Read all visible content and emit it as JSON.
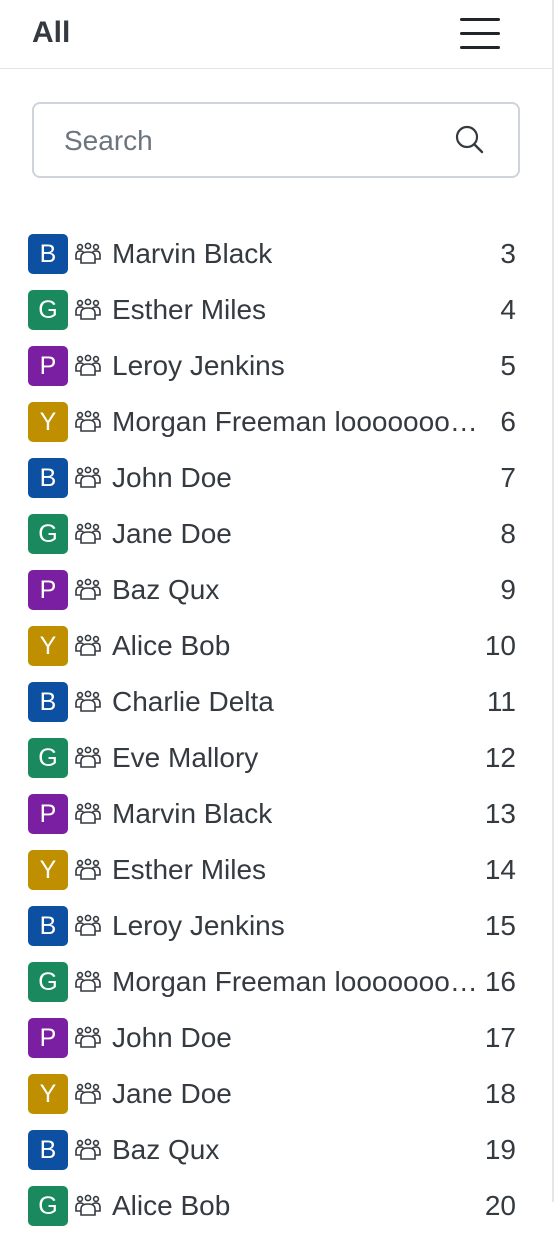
{
  "header": {
    "title": "All"
  },
  "search": {
    "placeholder": "Search",
    "value": ""
  },
  "colors": {
    "B": "#0d4fa0",
    "G": "#1a8a5e",
    "P": "#7b1fa2",
    "Y": "#bf8f00"
  },
  "items": [
    {
      "letter": "B",
      "color": "#0d4fa0",
      "name": "Marvin Black",
      "count": "3"
    },
    {
      "letter": "G",
      "color": "#1a8a5e",
      "name": "Esther Miles",
      "count": "4"
    },
    {
      "letter": "P",
      "color": "#7b1fa2",
      "name": "Leroy Jenkins",
      "count": "5"
    },
    {
      "letter": "Y",
      "color": "#bf8f00",
      "name": "Morgan Freeman looooooooooooooooong",
      "count": "6"
    },
    {
      "letter": "B",
      "color": "#0d4fa0",
      "name": "John Doe",
      "count": "7"
    },
    {
      "letter": "G",
      "color": "#1a8a5e",
      "name": "Jane Doe",
      "count": "8"
    },
    {
      "letter": "P",
      "color": "#7b1fa2",
      "name": "Baz Qux",
      "count": "9"
    },
    {
      "letter": "Y",
      "color": "#bf8f00",
      "name": "Alice Bob",
      "count": "10"
    },
    {
      "letter": "B",
      "color": "#0d4fa0",
      "name": "Charlie Delta",
      "count": "11"
    },
    {
      "letter": "G",
      "color": "#1a8a5e",
      "name": "Eve Mallory",
      "count": "12"
    },
    {
      "letter": "P",
      "color": "#7b1fa2",
      "name": "Marvin Black",
      "count": "13"
    },
    {
      "letter": "Y",
      "color": "#bf8f00",
      "name": "Esther Miles",
      "count": "14"
    },
    {
      "letter": "B",
      "color": "#0d4fa0",
      "name": "Leroy Jenkins",
      "count": "15"
    },
    {
      "letter": "G",
      "color": "#1a8a5e",
      "name": "Morgan Freeman looooooooooooooooong",
      "count": "16"
    },
    {
      "letter": "P",
      "color": "#7b1fa2",
      "name": "John Doe",
      "count": "17"
    },
    {
      "letter": "Y",
      "color": "#bf8f00",
      "name": "Jane Doe",
      "count": "18"
    },
    {
      "letter": "B",
      "color": "#0d4fa0",
      "name": "Baz Qux",
      "count": "19"
    },
    {
      "letter": "G",
      "color": "#1a8a5e",
      "name": "Alice Bob",
      "count": "20"
    }
  ]
}
